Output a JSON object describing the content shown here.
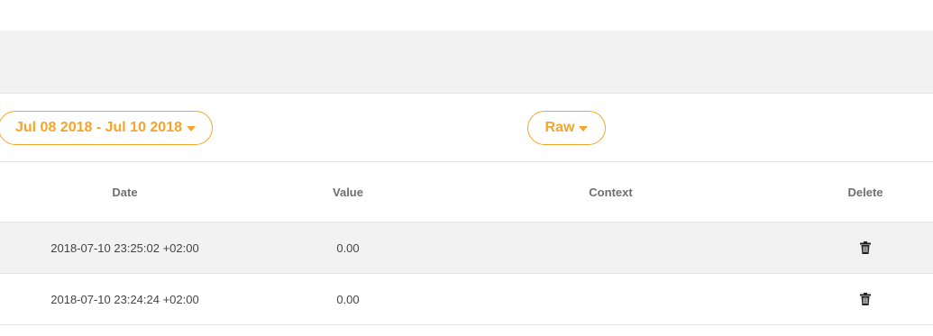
{
  "toolbar": {
    "date_range_label": "Jul 08 2018 - Jul 10 2018",
    "view_mode_label": "Raw"
  },
  "table": {
    "columns": [
      "Date",
      "Value",
      "Context",
      "Delete"
    ],
    "rows": [
      {
        "date": "2018-07-10 23:25:02 +02:00",
        "value": "0.00",
        "context": ""
      },
      {
        "date": "2018-07-10 23:24:24 +02:00",
        "value": "0.00",
        "context": ""
      }
    ]
  },
  "icons": {
    "delete": "trash-icon",
    "dropdown": "caret-down-icon"
  },
  "colors": {
    "accent": "#f4a42a",
    "band": "#f2f2f2",
    "header_text": "#6f6f6f",
    "row_text": "#444444"
  }
}
